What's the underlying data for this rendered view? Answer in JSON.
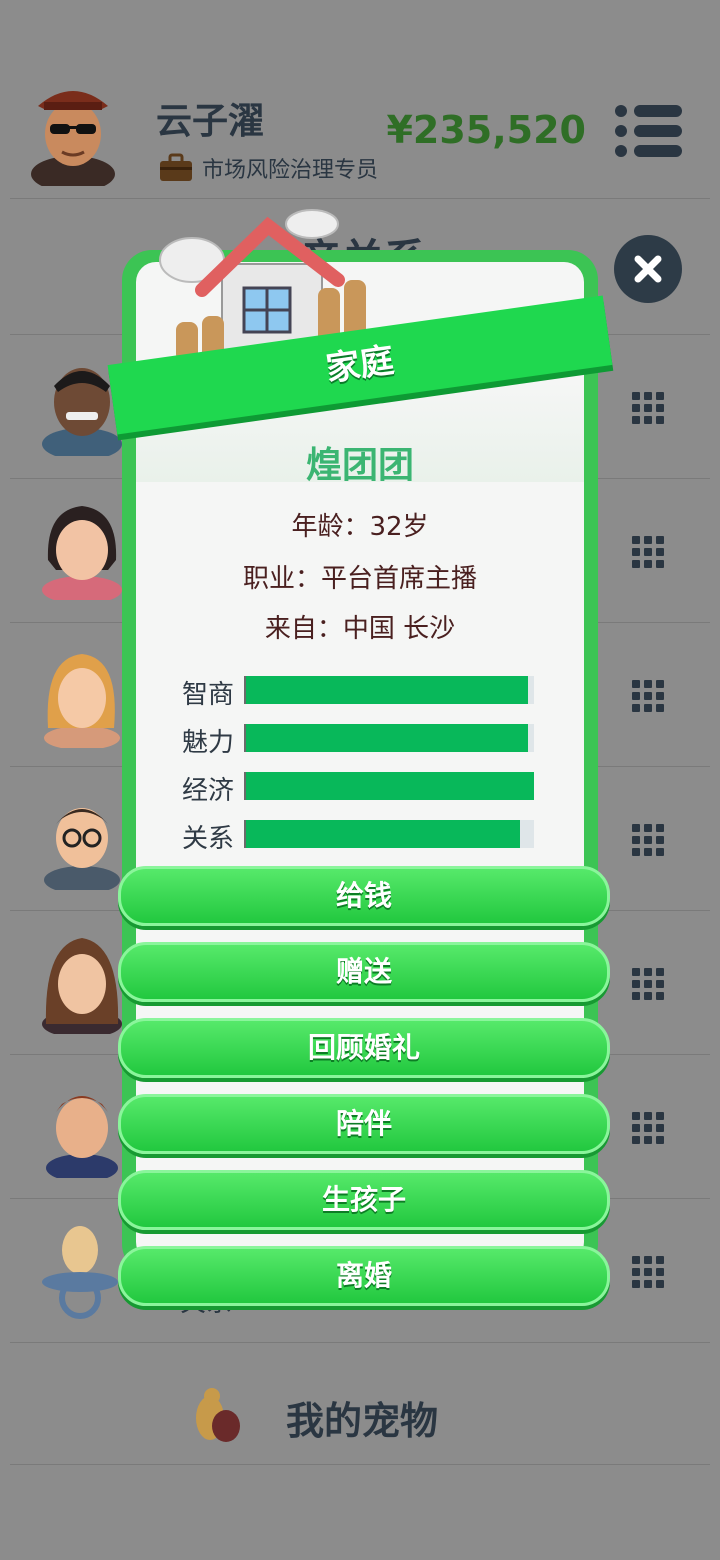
{
  "player": {
    "name": "云子濯",
    "job": "市场风险治理专员",
    "money": "¥235,520"
  },
  "background": {
    "heading": "亲关系",
    "pet_label": "我的宠物",
    "hidden_row_label": "关系"
  },
  "dialog": {
    "banner": "家庭",
    "npc_name": "煌团团",
    "age_line": "年龄：32岁",
    "job_line": "职业：平台首席主播",
    "from_line": "来自：中国 长沙",
    "stats": [
      {
        "label": "智商",
        "value": 0.98
      },
      {
        "label": "魅力",
        "value": 0.98
      },
      {
        "label": "经济",
        "value": 1.0
      },
      {
        "label": "关系",
        "value": 0.95
      }
    ],
    "actions": [
      "给钱",
      "赠送",
      "回顾婚礼",
      "陪伴",
      "生孩子",
      "离婚"
    ]
  },
  "colors": {
    "accent_green": "#1fd84f",
    "stat_fill": "#08b85a",
    "money": "#2f6e26",
    "overlay": "#8c8c8c"
  },
  "icons": [
    "avatar-player",
    "briefcase-icon",
    "menu-icon",
    "close-icon",
    "grid-icon",
    "house-icon",
    "pet-icon"
  ]
}
